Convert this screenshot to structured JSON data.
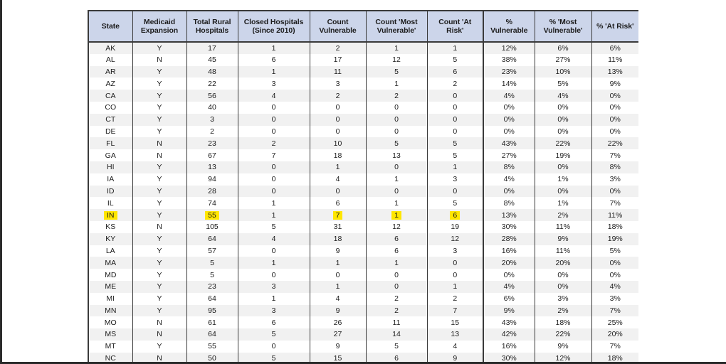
{
  "page": {
    "background_color": "#ffffff",
    "edge_strip_color": "#2b2b2b"
  },
  "table": {
    "header_fill": "#ccd5ea",
    "row_band_fill": "#f1f1f1",
    "highlight_color": "#ffe600",
    "border_color": "#3a3a3a",
    "columns": [
      {
        "key": "state",
        "label_lines": [
          "State"
        ]
      },
      {
        "key": "medicaid",
        "label_lines": [
          "Medicaid",
          "Expansion"
        ]
      },
      {
        "key": "total",
        "label_lines": [
          "Total Rural",
          "Hospitals"
        ]
      },
      {
        "key": "closed",
        "label_lines": [
          "Closed Hospitals",
          "(Since 2010)"
        ]
      },
      {
        "key": "cnt_vul",
        "label_lines": [
          "Count",
          "Vulnerable"
        ]
      },
      {
        "key": "cnt_most",
        "label_lines": [
          "Count 'Most",
          "Vulnerable'"
        ]
      },
      {
        "key": "cnt_risk",
        "label_lines": [
          "Count 'At",
          "Risk'"
        ]
      },
      {
        "key": "pct_vul",
        "label_lines": [
          "%",
          "Vulnerable"
        ]
      },
      {
        "key": "pct_most",
        "label_lines": [
          "% 'Most",
          "Vulnerable'"
        ]
      },
      {
        "key": "pct_risk",
        "label_lines": [
          "% 'At Risk'"
        ]
      }
    ],
    "rows": [
      {
        "state": "AK",
        "medicaid": "Y",
        "total": "17",
        "closed": "1",
        "cnt_vul": "2",
        "cnt_most": "1",
        "cnt_risk": "1",
        "pct_vul": "12%",
        "pct_most": "6%",
        "pct_risk": "6%"
      },
      {
        "state": "AL",
        "medicaid": "N",
        "total": "45",
        "closed": "6",
        "cnt_vul": "17",
        "cnt_most": "12",
        "cnt_risk": "5",
        "pct_vul": "38%",
        "pct_most": "27%",
        "pct_risk": "11%"
      },
      {
        "state": "AR",
        "medicaid": "Y",
        "total": "48",
        "closed": "1",
        "cnt_vul": "11",
        "cnt_most": "5",
        "cnt_risk": "6",
        "pct_vul": "23%",
        "pct_most": "10%",
        "pct_risk": "13%"
      },
      {
        "state": "AZ",
        "medicaid": "Y",
        "total": "22",
        "closed": "3",
        "cnt_vul": "3",
        "cnt_most": "1",
        "cnt_risk": "2",
        "pct_vul": "14%",
        "pct_most": "5%",
        "pct_risk": "9%"
      },
      {
        "state": "CA",
        "medicaid": "Y",
        "total": "56",
        "closed": "4",
        "cnt_vul": "2",
        "cnt_most": "2",
        "cnt_risk": "0",
        "pct_vul": "4%",
        "pct_most": "4%",
        "pct_risk": "0%"
      },
      {
        "state": "CO",
        "medicaid": "Y",
        "total": "40",
        "closed": "0",
        "cnt_vul": "0",
        "cnt_most": "0",
        "cnt_risk": "0",
        "pct_vul": "0%",
        "pct_most": "0%",
        "pct_risk": "0%"
      },
      {
        "state": "CT",
        "medicaid": "Y",
        "total": "3",
        "closed": "0",
        "cnt_vul": "0",
        "cnt_most": "0",
        "cnt_risk": "0",
        "pct_vul": "0%",
        "pct_most": "0%",
        "pct_risk": "0%"
      },
      {
        "state": "DE",
        "medicaid": "Y",
        "total": "2",
        "closed": "0",
        "cnt_vul": "0",
        "cnt_most": "0",
        "cnt_risk": "0",
        "pct_vul": "0%",
        "pct_most": "0%",
        "pct_risk": "0%"
      },
      {
        "state": "FL",
        "medicaid": "N",
        "total": "23",
        "closed": "2",
        "cnt_vul": "10",
        "cnt_most": "5",
        "cnt_risk": "5",
        "pct_vul": "43%",
        "pct_most": "22%",
        "pct_risk": "22%"
      },
      {
        "state": "GA",
        "medicaid": "N",
        "total": "67",
        "closed": "7",
        "cnt_vul": "18",
        "cnt_most": "13",
        "cnt_risk": "5",
        "pct_vul": "27%",
        "pct_most": "19%",
        "pct_risk": "7%"
      },
      {
        "state": "HI",
        "medicaid": "Y",
        "total": "13",
        "closed": "0",
        "cnt_vul": "1",
        "cnt_most": "0",
        "cnt_risk": "1",
        "pct_vul": "8%",
        "pct_most": "0%",
        "pct_risk": "8%"
      },
      {
        "state": "IA",
        "medicaid": "Y",
        "total": "94",
        "closed": "0",
        "cnt_vul": "4",
        "cnt_most": "1",
        "cnt_risk": "3",
        "pct_vul": "4%",
        "pct_most": "1%",
        "pct_risk": "3%"
      },
      {
        "state": "ID",
        "medicaid": "Y",
        "total": "28",
        "closed": "0",
        "cnt_vul": "0",
        "cnt_most": "0",
        "cnt_risk": "0",
        "pct_vul": "0%",
        "pct_most": "0%",
        "pct_risk": "0%"
      },
      {
        "state": "IL",
        "medicaid": "Y",
        "total": "74",
        "closed": "1",
        "cnt_vul": "6",
        "cnt_most": "1",
        "cnt_risk": "5",
        "pct_vul": "8%",
        "pct_most": "1%",
        "pct_risk": "7%"
      },
      {
        "state": "IN",
        "medicaid": "Y",
        "total": "55",
        "closed": "1",
        "cnt_vul": "7",
        "cnt_most": "1",
        "cnt_risk": "6",
        "pct_vul": "13%",
        "pct_most": "2%",
        "pct_risk": "11%",
        "highlight": [
          "state",
          "total",
          "cnt_vul",
          "cnt_most",
          "cnt_risk"
        ]
      },
      {
        "state": "KS",
        "medicaid": "N",
        "total": "105",
        "closed": "5",
        "cnt_vul": "31",
        "cnt_most": "12",
        "cnt_risk": "19",
        "pct_vul": "30%",
        "pct_most": "11%",
        "pct_risk": "18%"
      },
      {
        "state": "KY",
        "medicaid": "Y",
        "total": "64",
        "closed": "4",
        "cnt_vul": "18",
        "cnt_most": "6",
        "cnt_risk": "12",
        "pct_vul": "28%",
        "pct_most": "9%",
        "pct_risk": "19%"
      },
      {
        "state": "LA",
        "medicaid": "Y",
        "total": "57",
        "closed": "0",
        "cnt_vul": "9",
        "cnt_most": "6",
        "cnt_risk": "3",
        "pct_vul": "16%",
        "pct_most": "11%",
        "pct_risk": "5%"
      },
      {
        "state": "MA",
        "medicaid": "Y",
        "total": "5",
        "closed": "1",
        "cnt_vul": "1",
        "cnt_most": "1",
        "cnt_risk": "0",
        "pct_vul": "20%",
        "pct_most": "20%",
        "pct_risk": "0%"
      },
      {
        "state": "MD",
        "medicaid": "Y",
        "total": "5",
        "closed": "0",
        "cnt_vul": "0",
        "cnt_most": "0",
        "cnt_risk": "0",
        "pct_vul": "0%",
        "pct_most": "0%",
        "pct_risk": "0%"
      },
      {
        "state": "ME",
        "medicaid": "Y",
        "total": "23",
        "closed": "3",
        "cnt_vul": "1",
        "cnt_most": "0",
        "cnt_risk": "1",
        "pct_vul": "4%",
        "pct_most": "0%",
        "pct_risk": "4%"
      },
      {
        "state": "MI",
        "medicaid": "Y",
        "total": "64",
        "closed": "1",
        "cnt_vul": "4",
        "cnt_most": "2",
        "cnt_risk": "2",
        "pct_vul": "6%",
        "pct_most": "3%",
        "pct_risk": "3%"
      },
      {
        "state": "MN",
        "medicaid": "Y",
        "total": "95",
        "closed": "3",
        "cnt_vul": "9",
        "cnt_most": "2",
        "cnt_risk": "7",
        "pct_vul": "9%",
        "pct_most": "2%",
        "pct_risk": "7%"
      },
      {
        "state": "MO",
        "medicaid": "N",
        "total": "61",
        "closed": "6",
        "cnt_vul": "26",
        "cnt_most": "11",
        "cnt_risk": "15",
        "pct_vul": "43%",
        "pct_most": "18%",
        "pct_risk": "25%"
      },
      {
        "state": "MS",
        "medicaid": "N",
        "total": "64",
        "closed": "5",
        "cnt_vul": "27",
        "cnt_most": "14",
        "cnt_risk": "13",
        "pct_vul": "42%",
        "pct_most": "22%",
        "pct_risk": "20%"
      },
      {
        "state": "MT",
        "medicaid": "Y",
        "total": "55",
        "closed": "0",
        "cnt_vul": "9",
        "cnt_most": "5",
        "cnt_risk": "4",
        "pct_vul": "16%",
        "pct_most": "9%",
        "pct_risk": "7%"
      },
      {
        "state": "NC",
        "medicaid": "N",
        "total": "50",
        "closed": "5",
        "cnt_vul": "15",
        "cnt_most": "6",
        "cnt_risk": "9",
        "pct_vul": "30%",
        "pct_most": "12%",
        "pct_risk": "18%"
      }
    ]
  }
}
